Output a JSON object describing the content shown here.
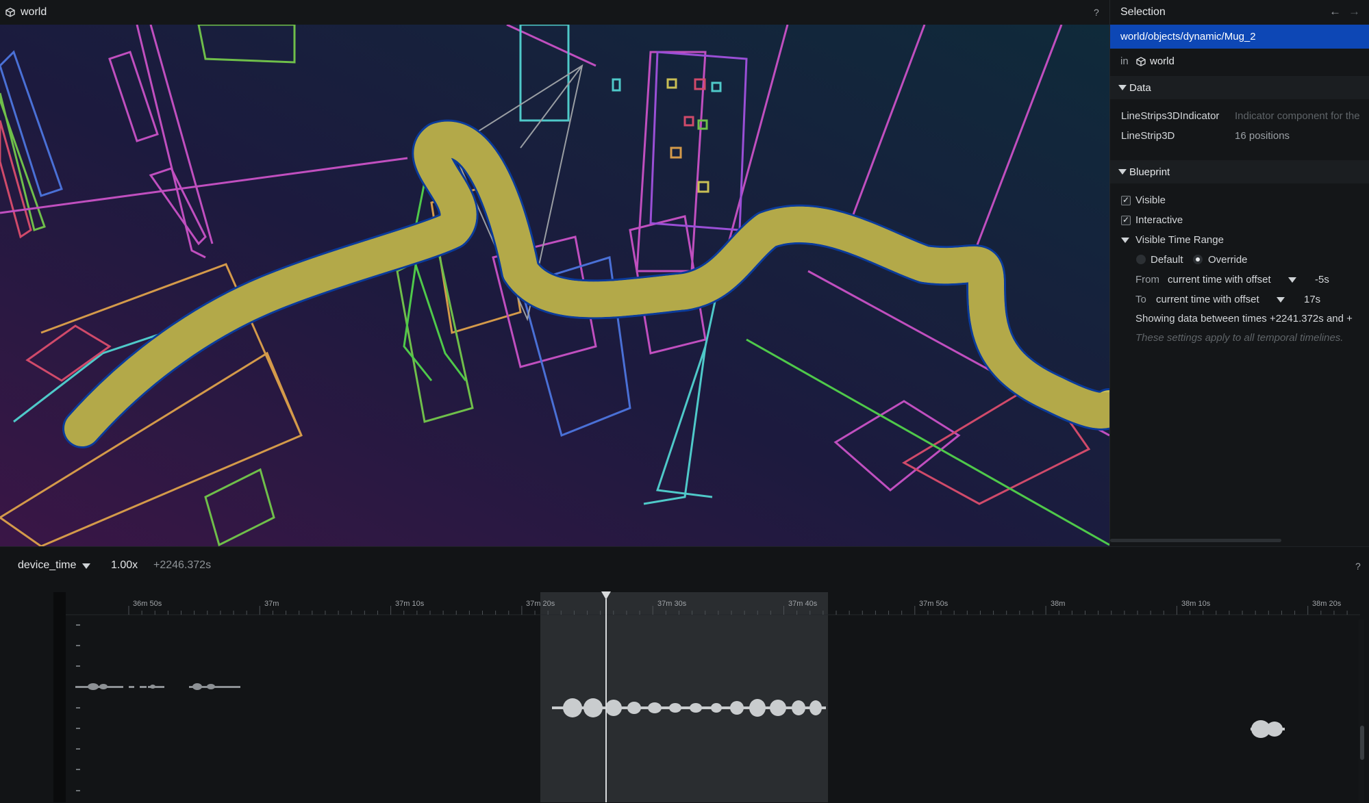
{
  "viewport": {
    "title": "world",
    "title_icon": "cube-icon",
    "help": "?"
  },
  "selection_panel": {
    "title": "Selection",
    "nav_back": "←",
    "nav_forward": "→",
    "entity_path": "world/objects/dynamic/Mug_2",
    "in_label": "in",
    "in_entity": "world",
    "in_entity_icon": "cube-icon",
    "data_section": {
      "label": "Data",
      "rows": [
        {
          "key": "LineStrips3DIndicator",
          "value": "Indicator component for the"
        },
        {
          "key": "LineStrip3D",
          "value": "16 positions"
        }
      ]
    },
    "blueprint_section": {
      "label": "Blueprint",
      "visible_label": "Visible",
      "visible_checked": true,
      "interactive_label": "Interactive",
      "interactive_checked": true,
      "time_range_label": "Visible Time Range",
      "default_label": "Default",
      "override_label": "Override",
      "override_selected": true,
      "from_label": "From",
      "from_mode": "current time with offset",
      "from_value": "-5s",
      "to_label": "To",
      "to_mode": "current time with offset",
      "to_value": "17s",
      "showing_text": "Showing data between times +2241.372s and +",
      "note": "These settings apply to all temporal timelines."
    }
  },
  "time_panel": {
    "timeline": "device_time",
    "speed": "1.00x",
    "current_time": "+2246.372s",
    "help": "?",
    "ticks": [
      "36m 50s",
      "37m",
      "37m 10s",
      "37m 20s",
      "37m 30s",
      "37m 40s",
      "37m 50s",
      "38m",
      "38m 10s",
      "38m 20s"
    ]
  },
  "colors": {
    "selection_blue": "#0d47b5",
    "trajectory_yellow": "#c9bf55",
    "background": "#121416"
  }
}
